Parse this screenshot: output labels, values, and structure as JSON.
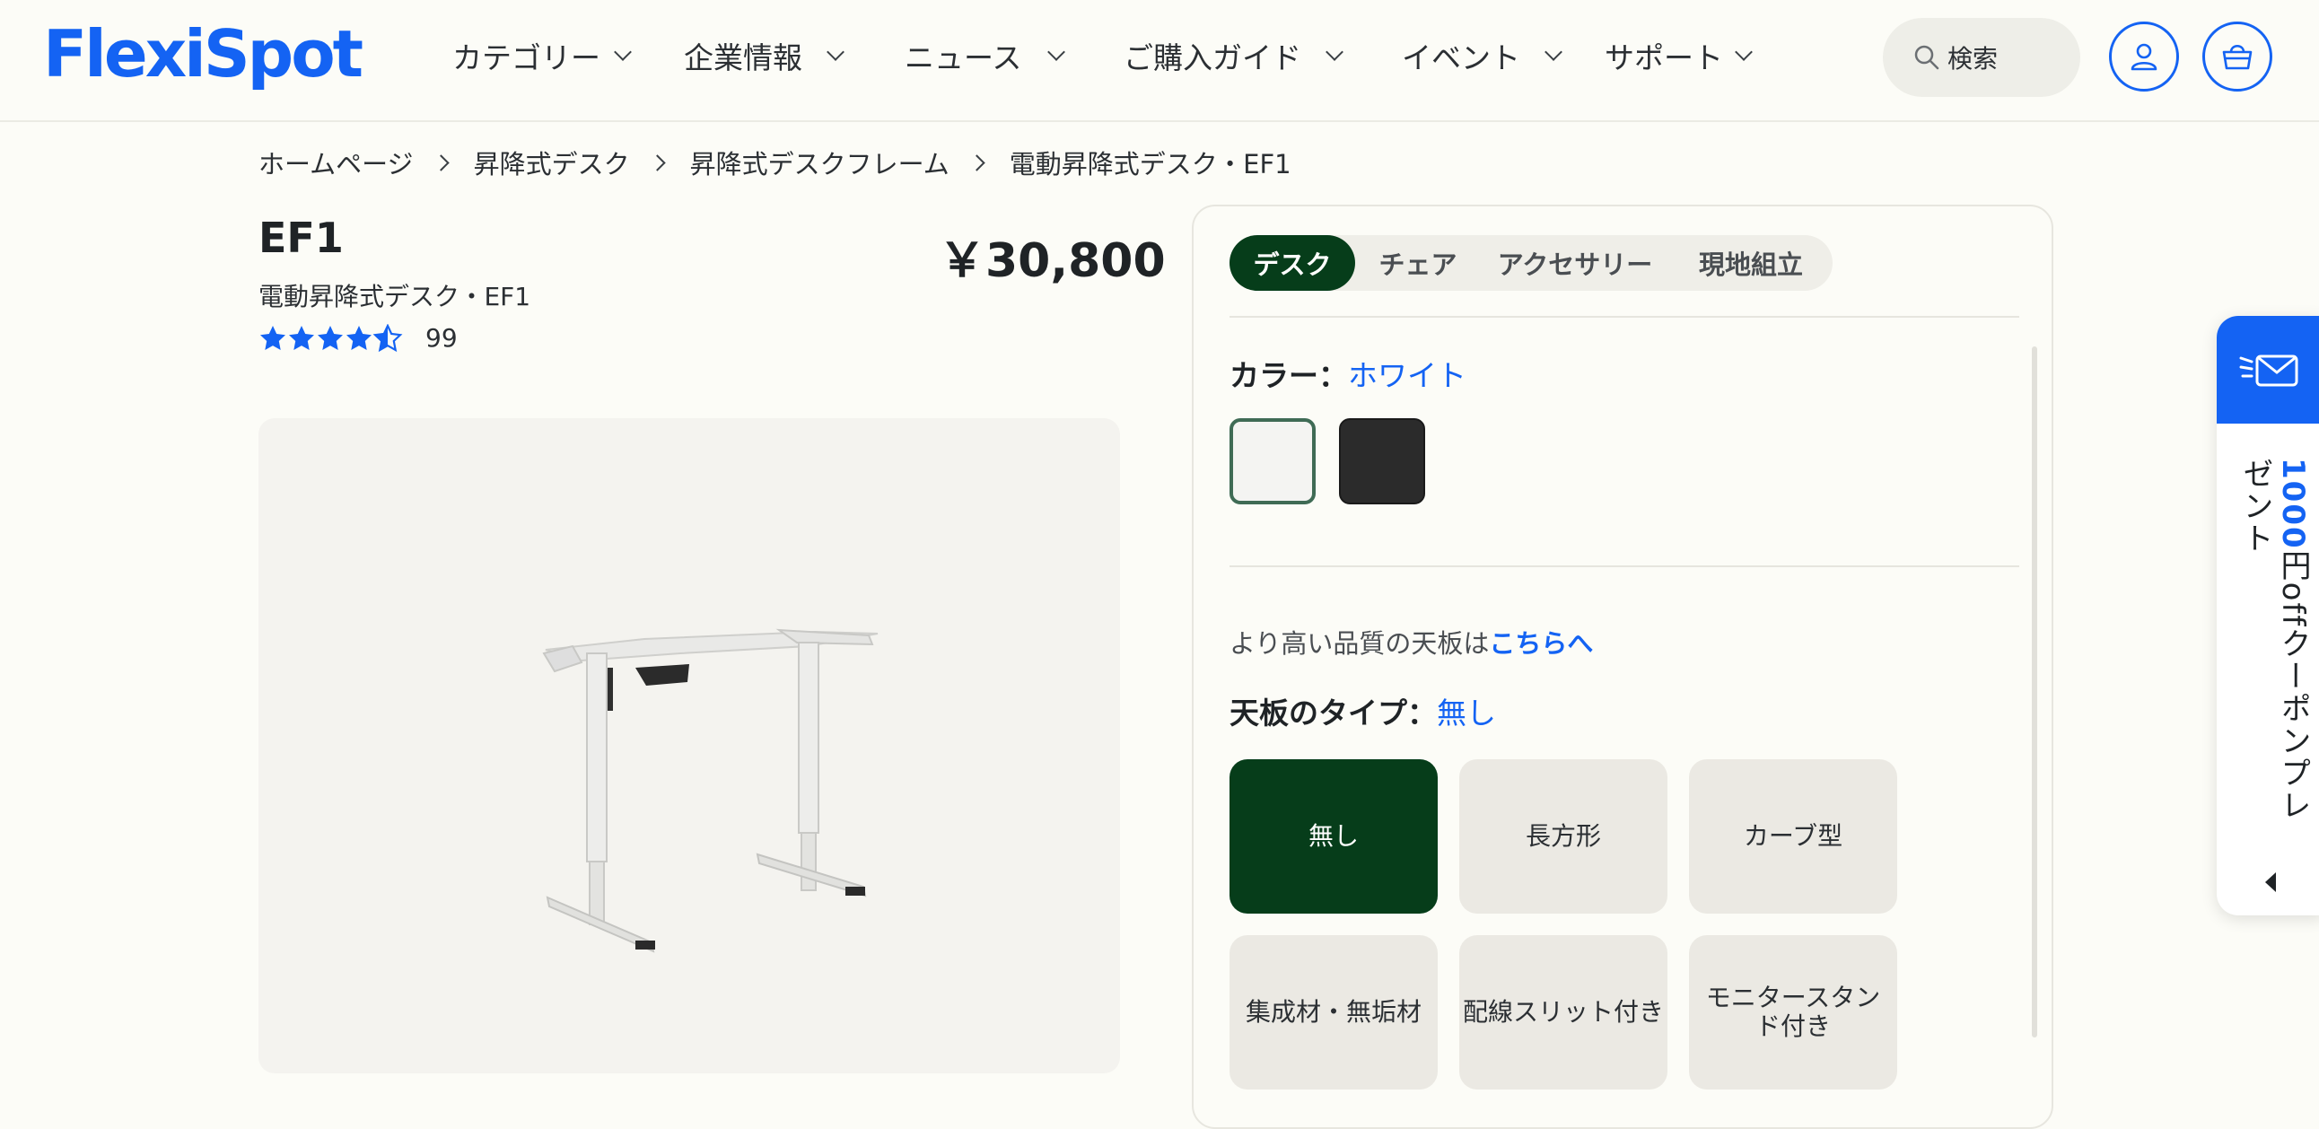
{
  "brand": {
    "logo_text": "FlexiSpot",
    "accent_color": "#1463f3",
    "dark_green": "#063d1a"
  },
  "nav": {
    "items": [
      "カテゴリー",
      "企業情報",
      "ニュース",
      "ご購入ガイド",
      "イベント",
      "サポート"
    ]
  },
  "search": {
    "placeholder": "検索",
    "icon": "search-icon"
  },
  "header_icons": [
    "user-icon",
    "cart-icon"
  ],
  "breadcrumb": [
    "ホームページ",
    "昇降式デスク",
    "昇降式デスクフレーム",
    "電動昇降式デスク・EF1"
  ],
  "product": {
    "name": "EF1",
    "subtitle": "電動昇降式デスク・EF1",
    "price": "￥30,800",
    "rating": 4.5,
    "review_count": "99"
  },
  "panel": {
    "tabs": [
      "デスク",
      "チェア",
      "アクセサリー",
      "現地組立"
    ],
    "active_tab": 0,
    "color_label": "カラー：",
    "color_value": "ホワイト",
    "swatches": [
      {
        "name": "ホワイト",
        "color": "#f4f4f2",
        "selected": true
      },
      {
        "name": "ブラック",
        "color": "#2b2b2b",
        "selected": false
      }
    ],
    "hint_text": "より高い品質の天板は",
    "hint_link": "こちらへ",
    "top_label": "天板のタイプ：",
    "top_value": "無し",
    "options": [
      "無し",
      "長方形",
      "カーブ型",
      "集成材・無垢材",
      "配線スリット付き",
      "モニタースタンド付き"
    ],
    "active_option": 0
  },
  "coupon": {
    "amount": "1000",
    "text": "円offクーポンプレゼント",
    "icon": "mail-icon"
  }
}
